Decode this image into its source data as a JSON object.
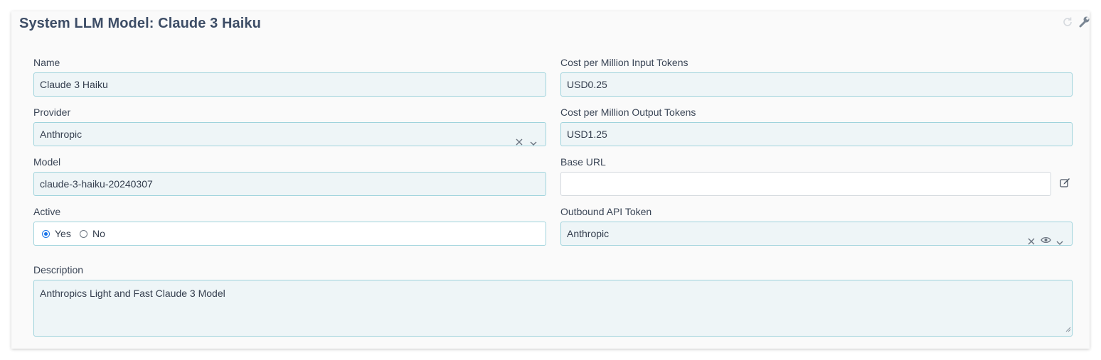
{
  "header": {
    "title": "System LLM Model: Claude 3 Haiku"
  },
  "fields": {
    "name": {
      "label": "Name",
      "value": "Claude 3 Haiku"
    },
    "provider": {
      "label": "Provider",
      "value": "Anthropic"
    },
    "model": {
      "label": "Model",
      "value": "claude-3-haiku-20240307"
    },
    "active": {
      "label": "Active",
      "options": [
        "Yes",
        "No"
      ],
      "selected": "Yes"
    },
    "cost_input": {
      "label": "Cost per Million Input Tokens",
      "value": "USD0.25"
    },
    "cost_output": {
      "label": "Cost per Million Output Tokens",
      "value": "USD1.25"
    },
    "base_url": {
      "label": "Base URL",
      "value": ""
    },
    "api_token": {
      "label": "Outbound API Token",
      "value": "Anthropic"
    },
    "description": {
      "label": "Description",
      "value": "Anthropics Light and Fast Claude 3 Model"
    }
  },
  "icons": {
    "refresh": "refresh-icon",
    "wrench": "wrench-icon",
    "clear": "close-icon",
    "dropdown": "chevron-down-icon",
    "edit": "edit-icon",
    "eye": "eye-icon"
  },
  "colors": {
    "title": "#3d4d66",
    "field_border": "#9fd3dc",
    "field_bg": "#eef5f7",
    "radio_accent": "#1a73e8"
  }
}
